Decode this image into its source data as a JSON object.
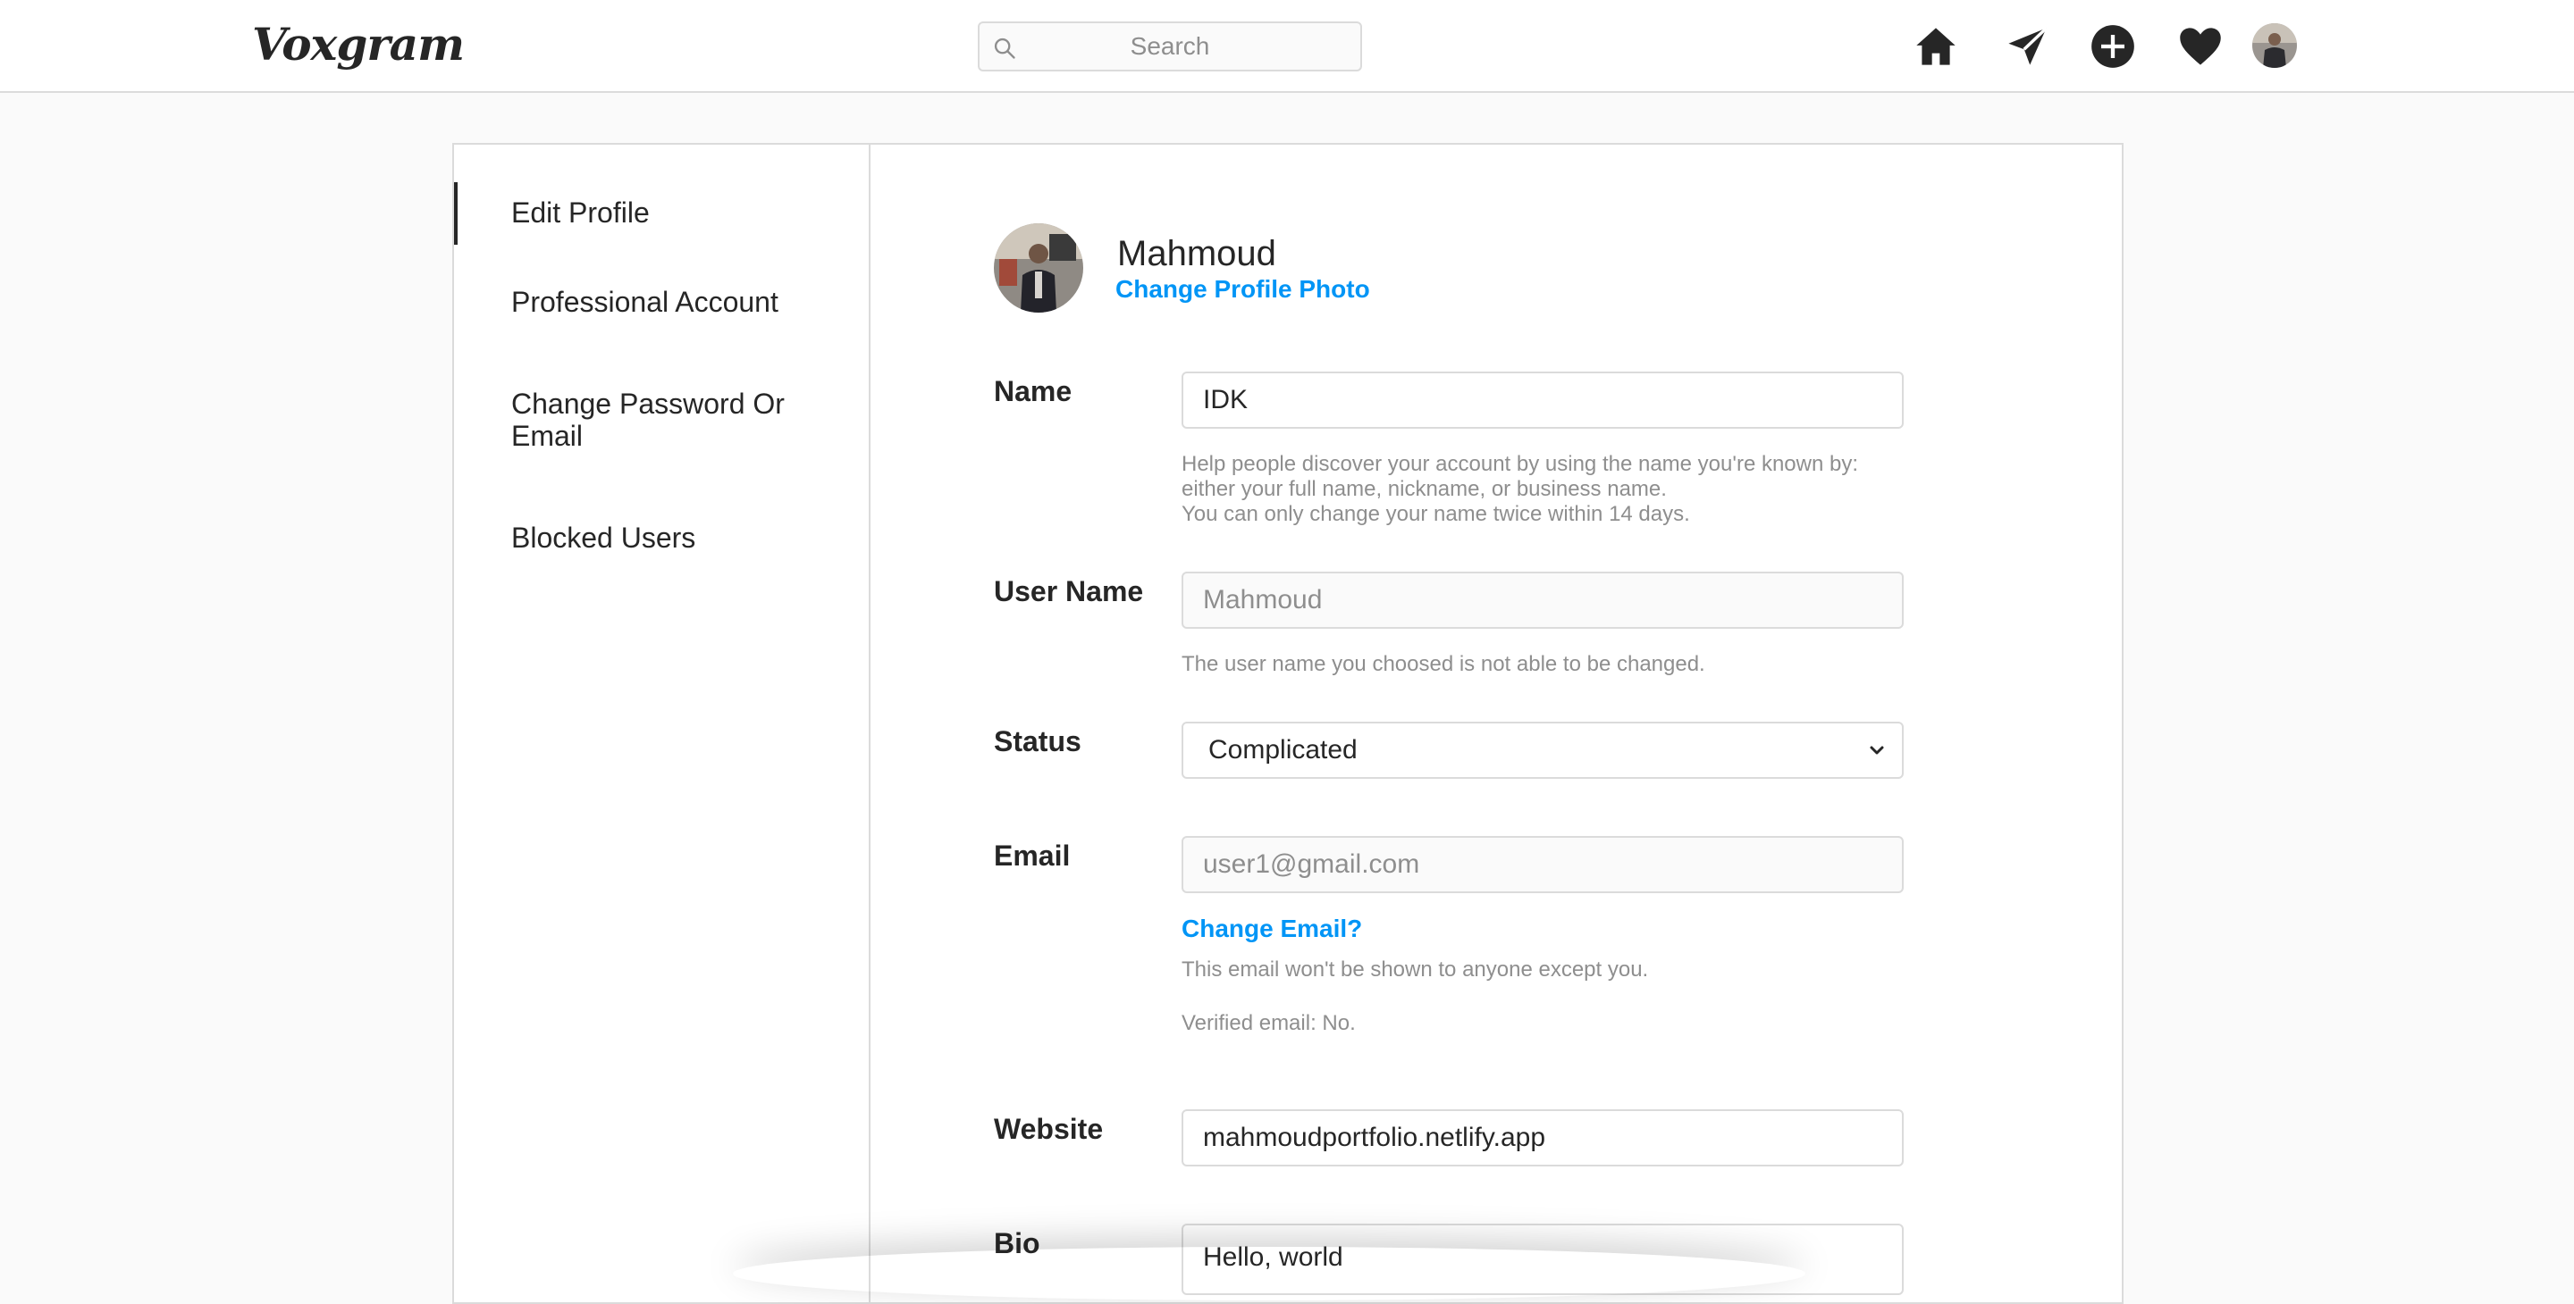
{
  "app": {
    "logo_text": "Voxgram",
    "search_placeholder": "Search"
  },
  "nav": {
    "icons": [
      "home-icon",
      "direct-send-icon",
      "new-post-icon",
      "activity-heart-icon",
      "profile-avatar"
    ]
  },
  "sidebar": {
    "items": [
      {
        "label": "Edit Profile",
        "active": true
      },
      {
        "label": "Professional Account",
        "active": false
      },
      {
        "label": "Change Password Or Email",
        "active": false
      },
      {
        "label": "Blocked Users",
        "active": false
      }
    ]
  },
  "profile": {
    "name": "Mahmoud",
    "change_photo_label": "Change Profile Photo"
  },
  "form": {
    "name": {
      "label": "Name",
      "value": "IDK",
      "hint_line1": "Help people discover your account by using the name you're known by:",
      "hint_line2": "either your full name, nickname, or business name.",
      "hint_line3": "You can only change your name twice within 14 days."
    },
    "username": {
      "label": "User Name",
      "value": "Mahmoud",
      "hint": "The user name you choosed is not able to be changed."
    },
    "status": {
      "label": "Status",
      "value": "Complicated"
    },
    "email": {
      "label": "Email",
      "value": "user1@gmail.com",
      "change_link": "Change Email?",
      "hint": "This email won't be shown to anyone except you.",
      "verified": "Verified email: No."
    },
    "website": {
      "label": "Website",
      "value": "mahmoudportfolio.netlify.app"
    },
    "bio": {
      "label": "Bio",
      "value": "Hello, world"
    }
  },
  "colors": {
    "accent": "#0095f6",
    "border": "#dbdbdb",
    "background": "#fafafa",
    "text": "#262626",
    "muted": "#8e8e8e"
  }
}
